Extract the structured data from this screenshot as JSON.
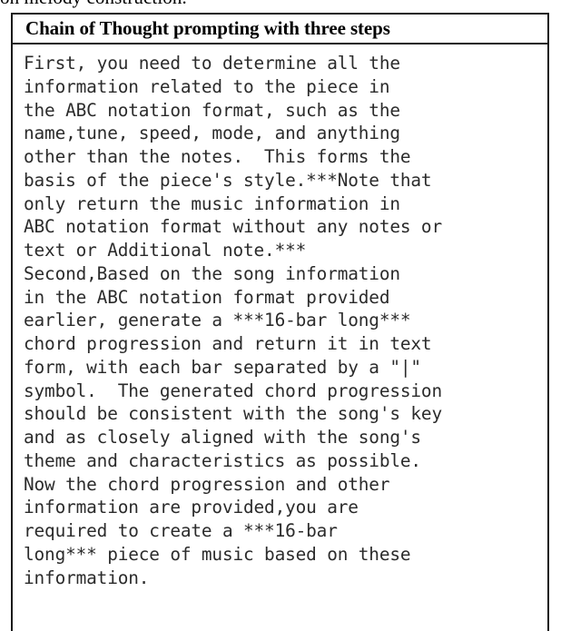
{
  "figure": {
    "clipped_caption_tail": "on melody construction.",
    "table": {
      "header": "Chain of Thought prompting with three steps",
      "body_lines": [
        "First, you need to determine all the",
        "information related to the piece in",
        "the ABC notation format, such as the",
        "name,tune, speed, mode, and anything",
        "other than the notes.  This forms the",
        "basis of the piece's style.***Note that",
        "only return the music information in",
        "ABC notation format without any notes or",
        "text or Additional note.***",
        "Second,Based on the song information",
        "in the ABC notation format provided",
        "earlier, generate a ***16-bar long***",
        "chord progression and return it in text",
        "form, with each bar separated by a \"|\"",
        "symbol.  The generated chord progression",
        "should be consistent with the song's key",
        "and as closely aligned with the song's",
        "theme and characteristics as possible.",
        "Now the chord progression and other",
        "information are provided,you are",
        "required to create a ***16-bar",
        "long*** piece of music based on these",
        "information."
      ],
      "body_text": "First, you need to determine all the\ninformation related to the piece in\nthe ABC notation format, such as the\nname,tune, speed, mode, and anything\nother than the notes.  This forms the\nbasis of the piece's style.***Note that\nonly return the music information in\nABC notation format without any notes or\ntext or Additional note.***\nSecond,Based on the song information\nin the ABC notation format provided\nearlier, generate a ***16-bar long***\nchord progression and return it in text\nform, with each bar separated by a \"|\"\nsymbol.  The generated chord progression\nshould be consistent with the song's key\nand as closely aligned with the song's\ntheme and characteristics as possible.\nNow the chord progression and other\ninformation are provided,you are\nrequired to create a ***16-bar\nlong*** piece of music based on these\ninformation."
    }
  },
  "colors": {
    "border": "#1a1a1a",
    "header_text": "#000000",
    "body_text": "#2b2b2b",
    "background": "#ffffff"
  }
}
